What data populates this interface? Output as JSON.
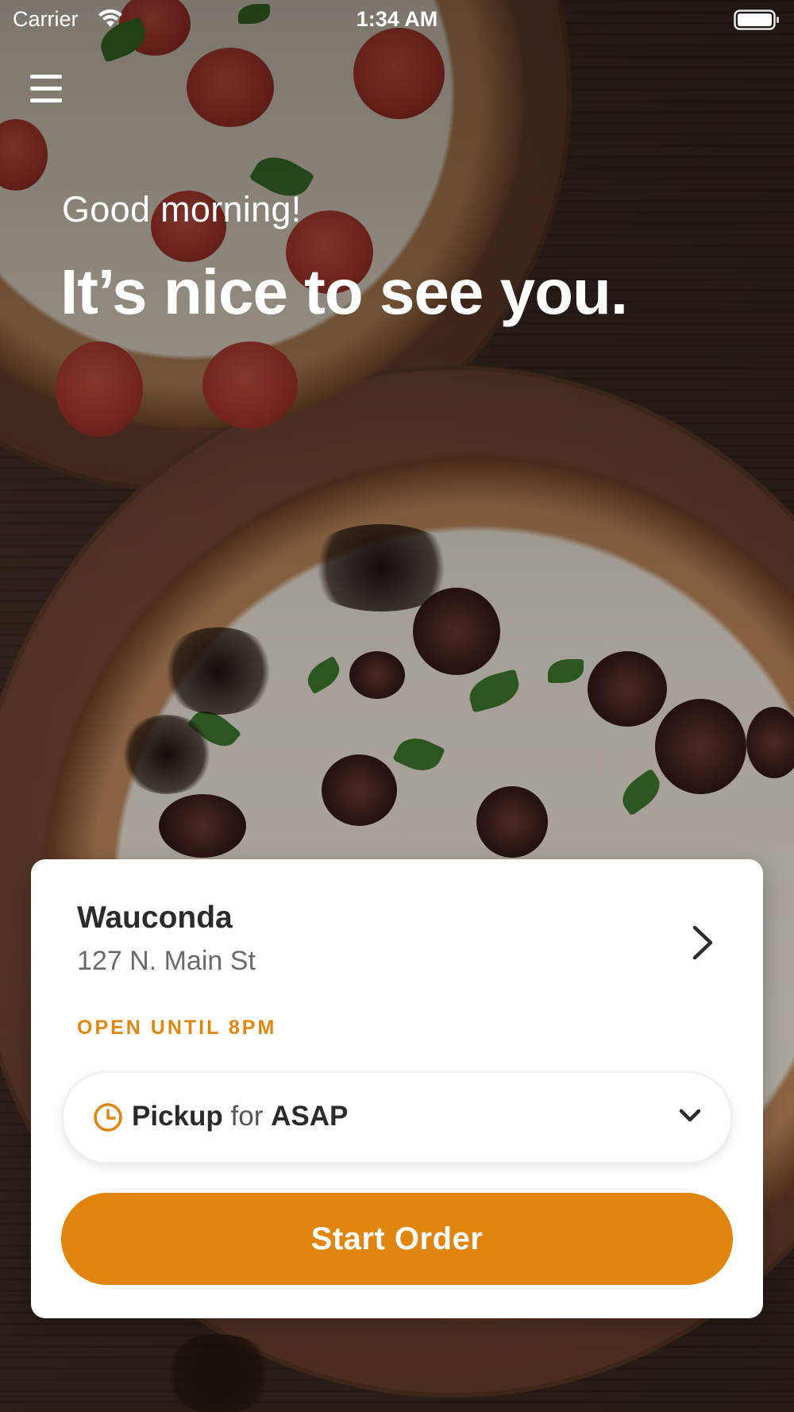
{
  "status_bar": {
    "carrier": "Carrier",
    "time": "1:34 AM"
  },
  "hero": {
    "greeting": "Good morning!",
    "headline": "It’s nice to see you."
  },
  "store": {
    "name": "Wauconda",
    "address": "127 N. Main St",
    "hours": "OPEN UNTIL 8PM"
  },
  "order_time": {
    "mode": "Pickup",
    "connector": "for",
    "when": "ASAP"
  },
  "actions": {
    "start_order": "Start Order"
  },
  "colors": {
    "accent": "#e0850e",
    "card": "#ffffff",
    "text_dark": "#2b2b2b",
    "text_muted": "#6a6a6a"
  },
  "icons": {
    "menu": "hamburger-menu-icon",
    "wifi": "wifi-icon",
    "battery": "battery-icon",
    "store_chevron": "chevron-right-icon",
    "clock": "clock-icon",
    "dropdown": "chevron-down-icon"
  }
}
